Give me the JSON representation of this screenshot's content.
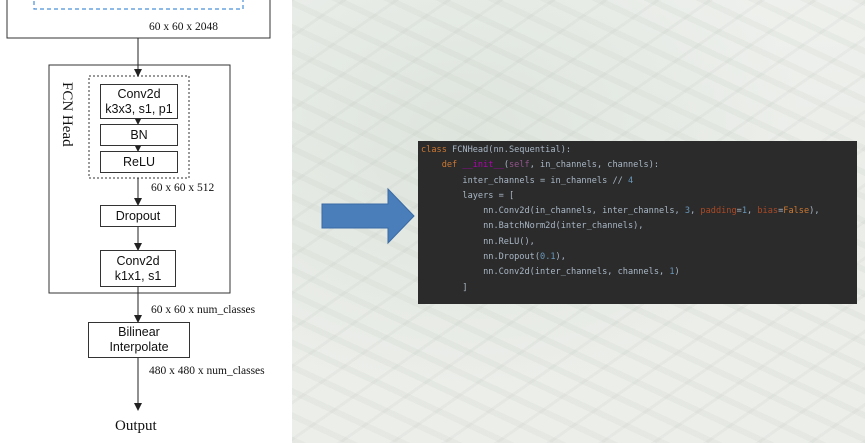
{
  "diagram": {
    "top_dims": "60 x 60 x 2048",
    "fcn_head_title": "FCN Head",
    "conv1_line1": "Conv2d",
    "conv1_line2": "k3x3, s1, p1",
    "bn": "BN",
    "relu": "ReLU",
    "dims_512": "60 x 60 x 512",
    "dropout": "Dropout",
    "conv2_line1": "Conv2d",
    "conv2_line2": "k1x1, s1",
    "dims_classes": "60 x 60 x num_classes",
    "bilinear_line1": "Bilinear",
    "bilinear_line2": "Interpolate",
    "dims_final": "480 x 480 x num_classes",
    "output": "Output"
  },
  "code": {
    "lines": [
      {
        "indent": 0,
        "tokens": [
          {
            "t": "class ",
            "c": "kw"
          },
          {
            "t": "FCNHead(nn.Sequential):",
            "c": "tx"
          }
        ]
      },
      {
        "indent": 4,
        "tokens": [
          {
            "t": "def ",
            "c": "kw"
          },
          {
            "t": "__init__",
            "c": "fn"
          },
          {
            "t": "(",
            "c": "tx"
          },
          {
            "t": "self",
            "c": "self"
          },
          {
            "t": ", in_channels, channels):",
            "c": "tx"
          }
        ]
      },
      {
        "indent": 8,
        "tokens": [
          {
            "t": "inter_channels = in_channels // ",
            "c": "tx"
          },
          {
            "t": "4",
            "c": "num"
          }
        ]
      },
      {
        "indent": 8,
        "tokens": [
          {
            "t": "layers = [",
            "c": "tx"
          }
        ]
      },
      {
        "indent": 12,
        "tokens": [
          {
            "t": "nn.Conv2d(in_channels, inter_channels, ",
            "c": "tx"
          },
          {
            "t": "3",
            "c": "num"
          },
          {
            "t": ", ",
            "c": "tx"
          },
          {
            "t": "padding",
            "c": "param"
          },
          {
            "t": "=",
            "c": "tx"
          },
          {
            "t": "1",
            "c": "num"
          },
          {
            "t": ", ",
            "c": "tx"
          },
          {
            "t": "bias",
            "c": "param"
          },
          {
            "t": "=",
            "c": "tx"
          },
          {
            "t": "False",
            "c": "kw"
          },
          {
            "t": "),",
            "c": "tx"
          }
        ]
      },
      {
        "indent": 12,
        "tokens": [
          {
            "t": "nn.BatchNorm2d(inter_channels),",
            "c": "tx"
          }
        ]
      },
      {
        "indent": 12,
        "tokens": [
          {
            "t": "nn.ReLU(),",
            "c": "tx"
          }
        ]
      },
      {
        "indent": 12,
        "tokens": [
          {
            "t": "nn.Dropout(",
            "c": "tx"
          },
          {
            "t": "0.1",
            "c": "num"
          },
          {
            "t": "),",
            "c": "tx"
          }
        ]
      },
      {
        "indent": 12,
        "tokens": [
          {
            "t": "nn.Conv2d(inter_channels, channels, ",
            "c": "tx"
          },
          {
            "t": "1",
            "c": "num"
          },
          {
            "t": ")",
            "c": "tx"
          }
        ]
      },
      {
        "indent": 8,
        "tokens": [
          {
            "t": "]",
            "c": "tx"
          }
        ]
      }
    ]
  },
  "colors": {
    "kw": "#cc7832",
    "fn": "#b200b2",
    "self": "#94558d",
    "num": "#6897bb",
    "param": "#aa4926",
    "tx": "#a9b7c6",
    "code_bg": "#2b2b2b",
    "arrow": "#4a7ebb",
    "dashed_blue": "#4a90d9"
  }
}
